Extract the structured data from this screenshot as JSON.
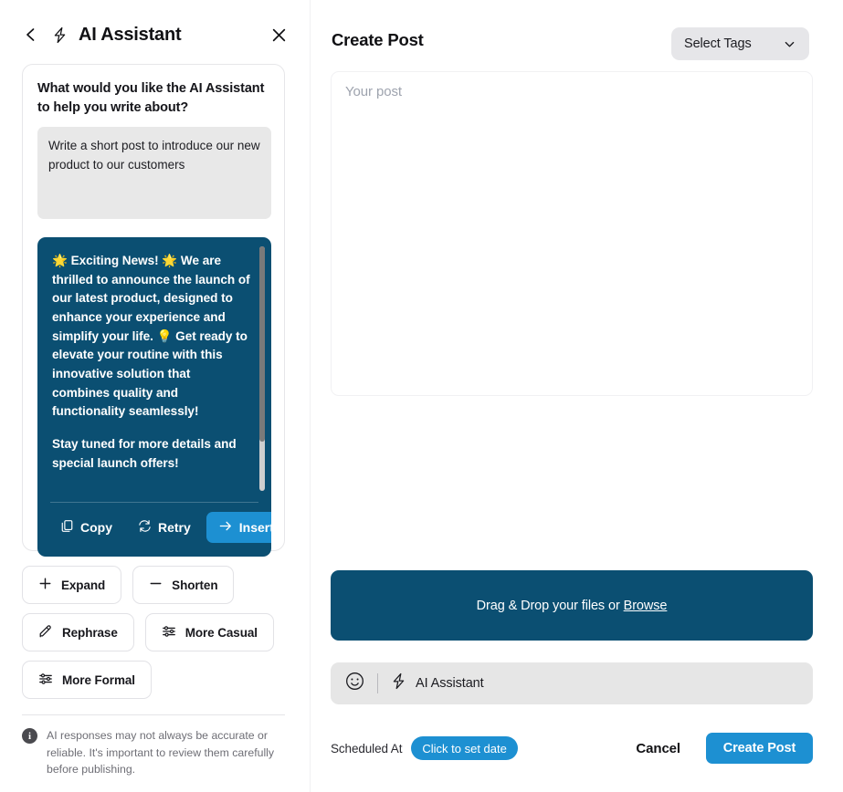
{
  "assistant": {
    "title": "AI Assistant",
    "back_icon": "chevron-left-icon",
    "bolt_icon": "lightning-bolt-icon",
    "close_icon": "close-icon",
    "question": "What would you like the AI Assistant to help you write about?",
    "prompt_value": "Write a short post to introduce our new product to our customers",
    "prompt_placeholder": "Write a short post to introduce our new product to our customers",
    "result_paragraph_1": "🌟 Exciting News! 🌟 We are thrilled to announce the launch of our latest product, designed to enhance your experience and simplify your life. 💡 Get ready to elevate your routine with this innovative solution that combines quality and functionality seamlessly!",
    "result_paragraph_2": "Stay tuned for more details and special launch offers!",
    "actions": [
      {
        "label": "Copy",
        "icon": "copy-icon"
      },
      {
        "label": "Retry",
        "icon": "refresh-icon"
      },
      {
        "label": "Insert",
        "icon": "arrow-right-icon"
      }
    ],
    "tone_buttons": [
      {
        "label": "Expand",
        "icon": "plus-icon"
      },
      {
        "label": "Shorten",
        "icon": "minus-icon"
      },
      {
        "label": "Rephrase",
        "icon": "pencil-square-icon"
      },
      {
        "label": "More Casual",
        "icon": "sliders-icon"
      },
      {
        "label": "More Formal",
        "icon": "sliders-icon"
      }
    ],
    "disclaimer_badge": "i",
    "disclaimer": "AI responses may not always be accurate or reliable. It's important to review them carefully before publishing."
  },
  "create_post": {
    "title": "Create Post",
    "tags": {
      "label": "Select Tags",
      "chevron_icon": "chevron-down-icon"
    },
    "post_placeholder": "Your post",
    "post_value": "",
    "dropzone": {
      "text": "Drag & Drop your files or ",
      "browse_label": "Browse"
    },
    "toolbar": {
      "emoji_icon": "smiley-face-icon",
      "ai_icon": "lightning-bolt-icon",
      "ai_label": "AI Assistant"
    },
    "footer": {
      "schedule_label": "Scheduled At",
      "schedule_button": "Click to set date",
      "cancel_label": "Cancel",
      "submit_label": "Create Post"
    }
  },
  "colors": {
    "navy": "#0b4f72",
    "accent_blue": "#1d90d2",
    "panel_gray": "#e6e6e6",
    "input_gray": "#e8e8e8"
  }
}
